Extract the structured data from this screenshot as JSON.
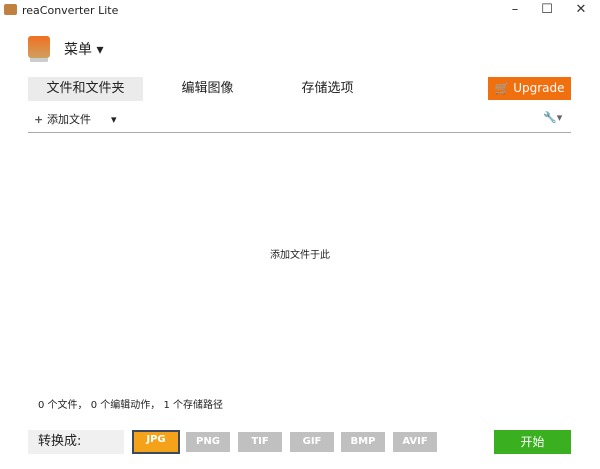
{
  "window": {
    "title": "reaConverter Lite",
    "minimize": "–",
    "maximize": "☐",
    "close": "✕"
  },
  "menu": {
    "label": "菜单 ▾"
  },
  "tabs": [
    {
      "label": "文件和文件夹"
    },
    {
      "label": "编辑图像"
    },
    {
      "label": "存储选项"
    }
  ],
  "upgrade": {
    "label": "Upgrade"
  },
  "toolbar": {
    "add_files": "添加文件",
    "tools": "▾"
  },
  "main": {
    "drop_hint": "添加文件于此"
  },
  "status": "0 个文件， 0 个编辑动作， 1 个存储路径",
  "convert": {
    "label": "转换成:",
    "formats": [
      "JPG",
      "PNG",
      "TIF",
      "GIF",
      "BMP",
      "AVIF"
    ],
    "selected": "JPG",
    "start": "开始"
  },
  "colors": {
    "accent": "#f07010",
    "start": "#3ab020",
    "selected": "#f5a21b"
  }
}
